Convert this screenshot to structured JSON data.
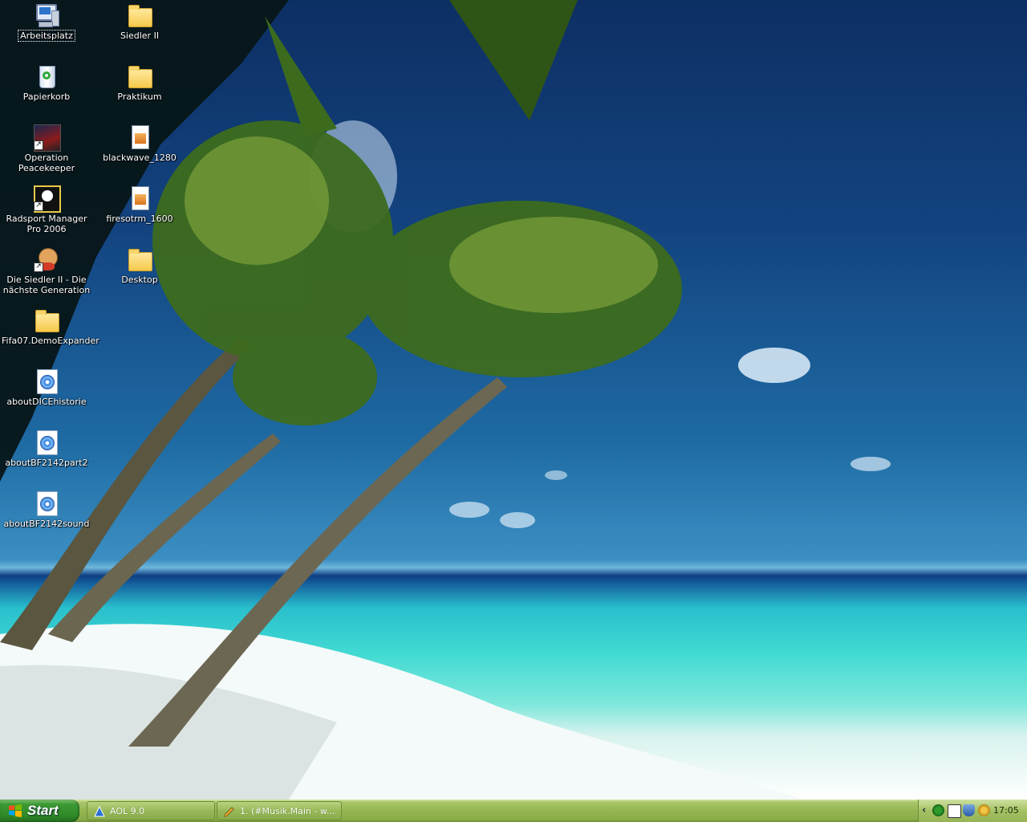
{
  "desktop": {
    "icons": [
      {
        "label": "Arbeitsplatz",
        "icon": "my-computer-icon"
      },
      {
        "label": "Papierkorb",
        "icon": "recycle-bin-icon"
      },
      {
        "label": "Operation Peacekeeper",
        "icon": "game-shortcut-icon"
      },
      {
        "label": "Radsport Manager Pro 2006",
        "icon": "cycling-game-shortcut-icon"
      },
      {
        "label": "Die Siedler II - Die nächste Generation",
        "icon": "settlers-game-shortcut-icon"
      },
      {
        "label": "Fifa07.DemoExpander",
        "icon": "folder-icon"
      },
      {
        "label": "aboutDICEhistorie",
        "icon": "media-file-icon"
      },
      {
        "label": "aboutBF2142part2",
        "icon": "media-file-icon"
      },
      {
        "label": "aboutBF2142sound",
        "icon": "media-file-icon"
      },
      {
        "label": "Siedler II",
        "icon": "folder-icon"
      },
      {
        "label": "Praktikum",
        "icon": "folder-icon"
      },
      {
        "label": "blackwave_1280",
        "icon": "image-file-icon"
      },
      {
        "label": "firesotrm_1600",
        "icon": "image-file-icon"
      },
      {
        "label": "Desktop",
        "icon": "folder-icon"
      }
    ]
  },
  "taskbar": {
    "start_label": "Start",
    "tasks": [
      {
        "label": "AOL 9.0",
        "icon": "aol-icon"
      },
      {
        "label": "1. (#Musik.Main - w...",
        "icon": "pencil-chat-icon"
      }
    ],
    "tray": {
      "expand": "‹",
      "icons": [
        "network-icon",
        "monitor-icon",
        "shield-icon",
        "globe-icon"
      ],
      "clock": "17:05"
    }
  },
  "colors": {
    "taskbar": "#94b551",
    "start": "#3c9a34",
    "sky": "#13437f",
    "sea": "#43dbd2"
  }
}
